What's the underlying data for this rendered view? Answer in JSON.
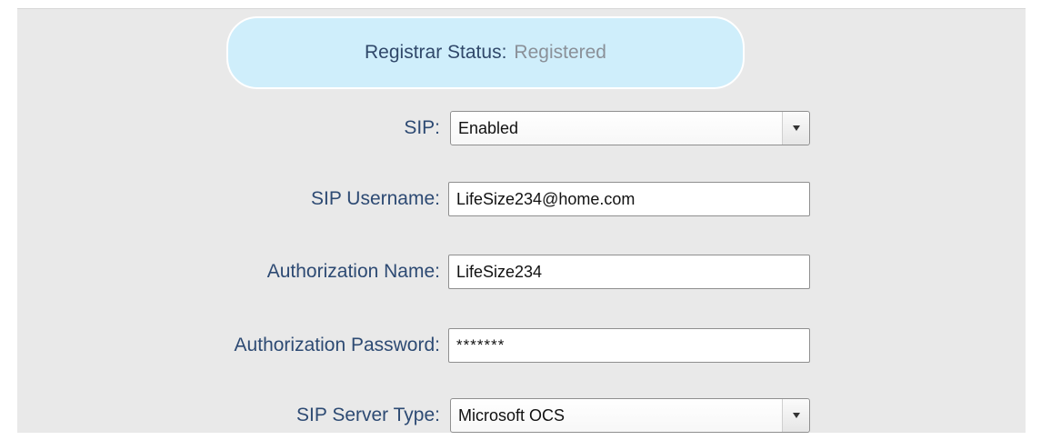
{
  "registrar": {
    "label": "Registrar Status:",
    "value": "Registered"
  },
  "fields": {
    "sip": {
      "label": "SIP:",
      "value": "Enabled"
    },
    "sip_username": {
      "label": "SIP Username:",
      "value": "LifeSize234@home.com"
    },
    "authorization_name": {
      "label": "Authorization Name:",
      "value": "LifeSize234"
    },
    "authorization_password": {
      "label": "Authorization Password:",
      "value": "*******"
    },
    "sip_server_type": {
      "label": "SIP Server Type:",
      "value": "Microsoft OCS"
    }
  },
  "icons": {
    "dropdown": "chevron-down-icon"
  },
  "colors": {
    "background": "#e9e9e9",
    "status_fill": "#cfeefb",
    "label_text": "#2d4a73",
    "status_value": "#8a9098"
  }
}
